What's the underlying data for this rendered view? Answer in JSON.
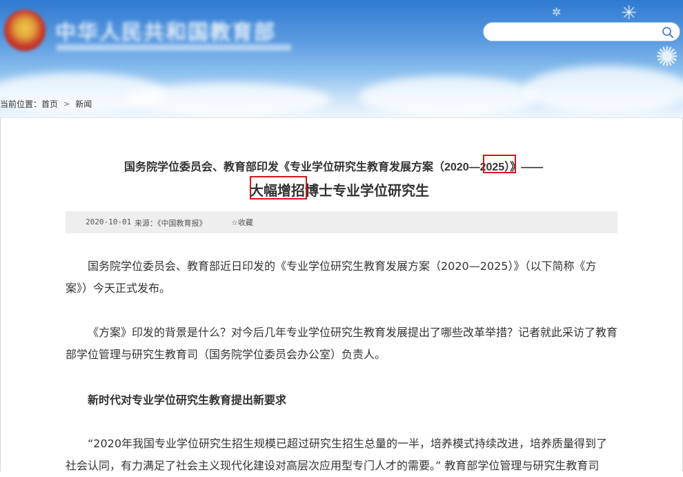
{
  "header": {
    "site_name": "中华人民共和国教育部",
    "search": {
      "placeholder": ""
    }
  },
  "breadcrumb": {
    "prefix": "当前位置：",
    "items": [
      "首页",
      "新闻"
    ],
    "separator": ">"
  },
  "article": {
    "title_line1": "国务院学位委员会、教育部印发《专业学位研究生教育发展方案（2020—2025）》——",
    "title_line2": "大幅增招博士专业学位研究生",
    "date": "2020-10-01",
    "source": "来源：《中国教育报》",
    "favorite_label": "☆收藏",
    "paragraphs": [
      "国务院学位委员会、教育部近日印发的《专业学位研究生教育发展方案（2020—2025）》（以下简称《方案》）今天正式发布。",
      "《方案》印发的背景是什么？对今后几年专业学位研究生教育发展提出了哪些改革举措？记者就此采访了教育部学位管理与研究生教育司（国务院学位委员会办公室）负责人。"
    ],
    "subheading": "新时代对专业学位研究生教育提出新要求",
    "paragraph3": "“2020年我国专业学位研究生招生规模已超过研究生招生总量的一半，培养模式持续改进，培养质量得到了社会认同，有力满足了社会主义现代化建设对高层次应用型专门人才的需要。” 教育部学位管理与研究生教育司"
  },
  "annotations": {
    "highlight_color": "#d8141b"
  }
}
